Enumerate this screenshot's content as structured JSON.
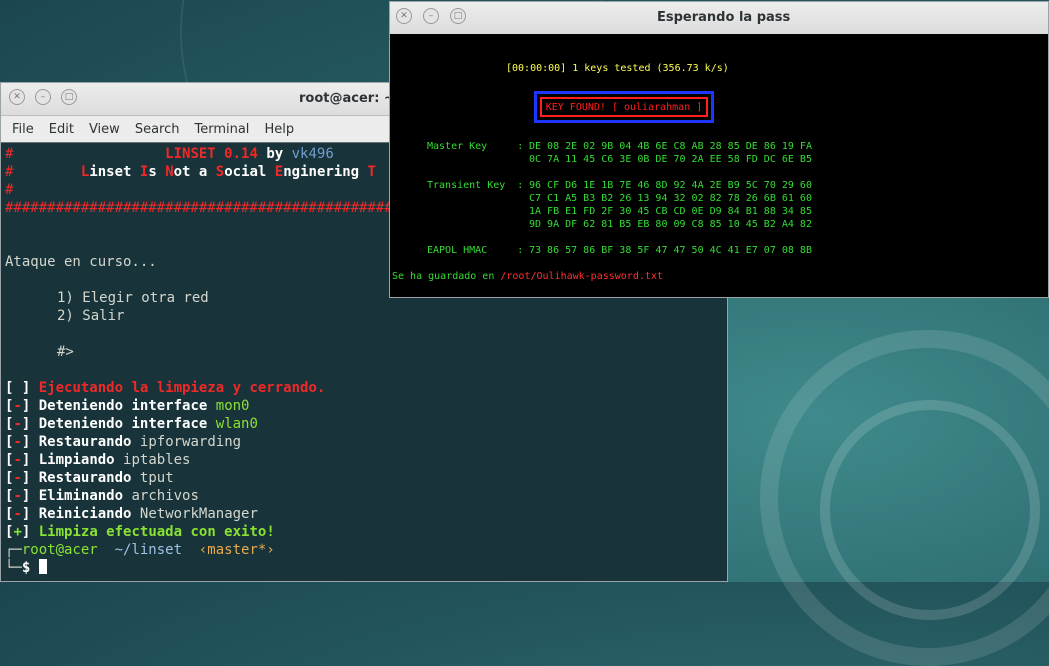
{
  "terminal": {
    "title": "root@acer: ~",
    "menu": [
      "File",
      "Edit",
      "View",
      "Search",
      "Terminal",
      "Help"
    ],
    "banner": {
      "hash": "#",
      "name": "LINSET 0.14",
      "by": "by",
      "author": "vk496",
      "tagline": [
        "L",
        "inset ",
        "I",
        "s ",
        "N",
        "ot a ",
        "S",
        "ocial ",
        "E",
        "nginering ",
        "T"
      ],
      "separator": "#######################################################"
    },
    "status": "Ataque en curso...",
    "options": [
      "1) Elegir otra red",
      "2) Salir"
    ],
    "prompt_input": "#>",
    "cleanup_header_mark": "[ ]",
    "cleanup_header": "Ejecutando la limpieza y cerrando.",
    "steps": [
      {
        "mark": "[-]",
        "verb": "Deteniendo interface",
        "obj": "mon0",
        "obj_color": "green"
      },
      {
        "mark": "[-]",
        "verb": "Deteniendo interface",
        "obj": "wlan0",
        "obj_color": "green"
      },
      {
        "mark": "[-]",
        "verb": "Restaurando",
        "obj": "ipforwarding",
        "obj_color": "plain"
      },
      {
        "mark": "[-]",
        "verb": "Limpiando",
        "obj": "iptables",
        "obj_color": "plain"
      },
      {
        "mark": "[-]",
        "verb": "Restaurando",
        "obj": "tput",
        "obj_color": "plain"
      },
      {
        "mark": "[-]",
        "verb": "Eliminando",
        "obj": "archivos",
        "obj_color": "plain"
      },
      {
        "mark": "[-]",
        "verb": "Reiniciando",
        "obj": "NetworkManager",
        "obj_color": "plain"
      }
    ],
    "done_mark": "[+]",
    "done_text": "Limpiza efectuada con exito!",
    "shell": {
      "corner_top": "┌─",
      "user": "root@acer",
      "path": "~/linset",
      "branch": "‹master*›",
      "corner_bottom": "└─",
      "symbol": "$"
    }
  },
  "crack": {
    "title": "Esperando la pass",
    "progress": "[00:00:00] 1 keys tested (356.73 k/s)",
    "key_found": "KEY FOUND! [ ouliarahman ]",
    "master_label": "Master Key     :",
    "master": [
      "DE 08 2E 02 9B 04 4B 6E C8 AB 28 85 DE 86 19 FA",
      "0C 7A 11 45 C6 3E 0B DE 70 2A EE 58 FD DC 6E B5"
    ],
    "transient_label": "Transient Key  :",
    "transient": [
      "96 CF D6 1E 1B 7E 46 8D 92 4A 2E B9 5C 70 29 60",
      "C7 C1 A5 B3 B2 26 13 94 32 02 82 78 26 6B 61 60",
      "1A FB E1 FD 2F 30 45 CB CD 0E D9 84 B1 88 34 85",
      "9D 9A DF 62 81 B5 EB 80 09 C8 85 10 45 B2 A4 82"
    ],
    "eapol_label": "EAPOL HMAC     :",
    "eapol": "73 86 57 86 BF 38 5F 47 47 50 4C 41 E7 07 08 8B",
    "saved_prefix": "Se ha guardado en ",
    "saved_path": "/root/Oulihawk-password.txt"
  }
}
